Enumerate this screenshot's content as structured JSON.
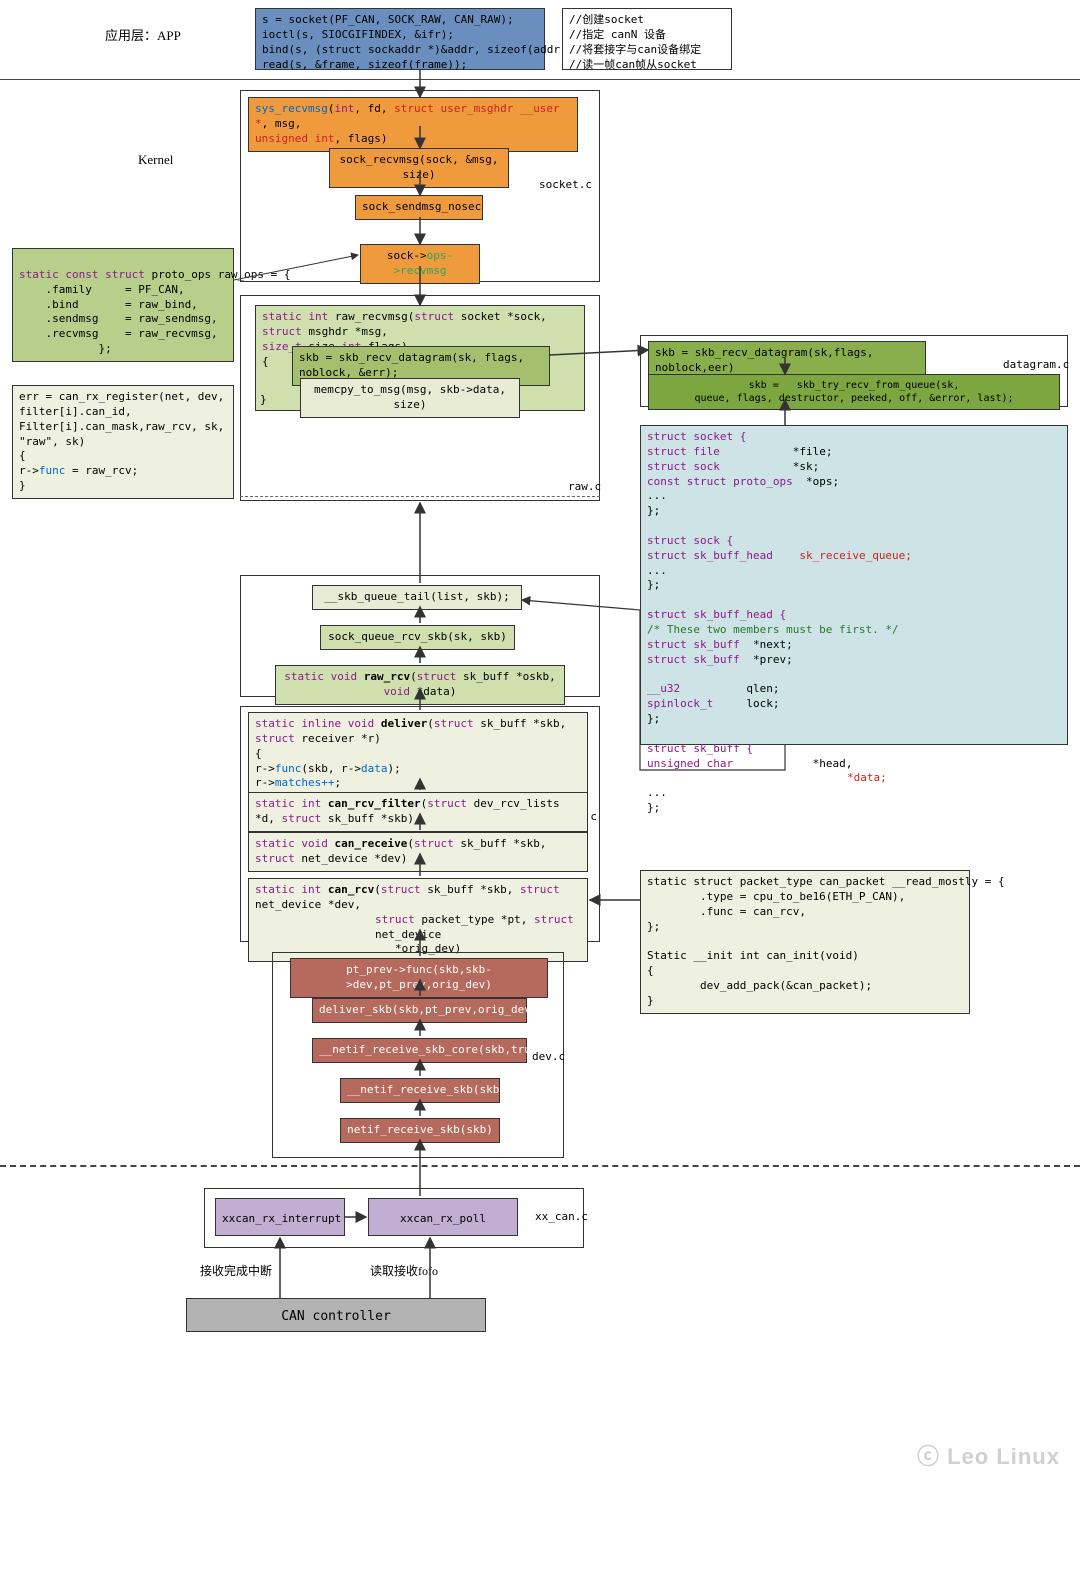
{
  "labels": {
    "app_layer": "应用层：APP",
    "kernel": "Kernel",
    "socket_c": "socket.c",
    "raw_c": "raw.c",
    "datagram_c": "datagram.c",
    "af_can_c": "af_can.c",
    "dev_c": "dev.c",
    "xx_can_c": "xx_can.c",
    "rx_done_irq": "接收完成中断",
    "read_rx_fifo": "读取接收fofo",
    "watermark": "ⓒ Leo Linux"
  },
  "app_code": "s = socket(PF_CAN, SOCK_RAW, CAN_RAW);\nioctl(s, SIOCGIFINDEX, &ifr);\nbind(s, (struct sockaddr *)&addr, sizeof(addr));\nread(s, &frame, sizeof(frame));",
  "app_comments": "//创建socket\n//指定 canN 设备\n//将套接字与can设备绑定\n//读一帧can帧从socket",
  "sys_recvmsg": {
    "tok1": "sys_recvmsg",
    "tok2": "(",
    "tok3": "int",
    "tok4": ", fd, ",
    "tok5": "struct user_msghdr __user *",
    "tok6": ", msg,",
    "tok7": "unsigned int",
    "tok8": ", flags)"
  },
  "sock_recvmsg": "sock_recvmsg(sock, &msg, size)",
  "sock_sendmsg": "sock_sendmsg_nosec",
  "sock_ops": {
    "pre": "sock->",
    "mid": "ops->recvmsg"
  },
  "proto_ops": "static const struct proto_ops raw_ops = {\n    .family     = PF_CAN,\n    .bind       = raw_bind,\n    .sendmsg    = raw_sendmsg,\n    .recvmsg    = raw_recvmsg,\n            };",
  "can_rx_reg": {
    "l1": "err = can_rx_register(net, dev, filter[i].can_id,",
    "l2": "Filter[i].can_mask,raw_rcv, sk, \"raw\", sk)",
    "l3": "{",
    "l4pre": "    r->",
    "l4kw": "func",
    "l4post": "   = raw_rcv;",
    "l5": "}"
  },
  "raw_recvmsg_hdr": {
    "p1": "static int ",
    "fn": "raw_recvmsg",
    "p2": "(",
    "kw1": "struct",
    "p3": " socket *sock, ",
    "kw2": "struct",
    "p4": " msghdr *msg,",
    "l2a": "size_t ",
    "l2b": "size,",
    "l2c": "int ",
    "l2d": "flags)",
    "br": "{"
  },
  "skb_recv_dg": "skb = skb_recv_datagram(sk, flags, noblock, &err);",
  "memcpy_to_msg": "memcpy_to_msg(msg, skb->data, size)",
  "raw_recvmsg_end": "}",
  "skb_recv_dg2": "skb = skb_recv_datagram(sk,flags, noblock,eer)",
  "skb_try_recv": "skb =   skb_try_recv_from_queue(sk,\nqueue, flags, destructor, peeked, off, &error, last);",
  "structs": {
    "socket_hdr": "struct socket {",
    "file": "        struct file",
    "file_m": "*file;",
    "sock": "        struct sock",
    "sock_m": "*sk;",
    "ops": "        const struct proto_ops",
    "ops_m": "*ops;",
    "dots": "            ...",
    "end": "};",
    "sock2_hdr": "struct sock {",
    "skbh": "        struct sk_buff_head",
    "skbh_m": "sk_receive_queue;",
    "skbuffh_hdr": "struct sk_buff_head {",
    "comment": "        /* These two members must be first. */",
    "next": "        struct sk_buff",
    "next_m": "*next;",
    "prev": "        struct sk_buff",
    "prev_m": "*prev;",
    "u32": "        __u32",
    "u32_m": "qlen;",
    "spin": "        spinlock_t",
    "spin_m": "lock;",
    "skbuff_hdr": "struct sk_buff {",
    "uchar": "        unsigned char",
    "uchar_m1": "*head,",
    "uchar_m2": "*data;"
  },
  "skb_queue_tail": "__skb_queue_tail(list, skb);",
  "sock_queue_rcv": "sock_queue_rcv_skb(sk, skb)",
  "raw_rcv": {
    "p1": "static void ",
    "fn": "raw_rcv",
    "p2": "(",
    "kw": "struct",
    "p3": " sk_buff *oskb, ",
    "kw2": "void",
    "p4": " *data)"
  },
  "deliver": {
    "p1": "static inline void ",
    "fn": "deliver",
    "p2": "(",
    "kw1": "struct",
    "p3": " sk_buff *skb, ",
    "kw2": "struct",
    "p4": " receiver *r)",
    "br": "{",
    "b1": "        r->",
    "b1_kw": "func",
    "b1_p": "(skb, r->",
    "b1_kw2": "data",
    "b1_p2": ");",
    "b2": "        r->",
    "b2_kw": "matches++",
    "b2_p": ";",
    "end": "}"
  },
  "can_rcv_filter": {
    "p1": "static int ",
    "fn": "can_rcv_filter",
    "p2": "(",
    "kw": "struct",
    "p3": " dev_rcv_lists *d, ",
    "kw2": "struct",
    "p4": " sk_buff *skb)"
  },
  "can_receive": {
    "p1": "static void ",
    "fn": "can_receive",
    "p2": "(",
    "kw": "struct",
    "p3": " sk_buff *skb, ",
    "kw2": "struct",
    "p4": " net_device *dev)"
  },
  "can_rcv": {
    "p1": "static int ",
    "fn": "can_rcv",
    "p2": "(",
    "kw": "struct",
    "p3": " sk_buff *skb, ",
    "kw2": "struct",
    "p4": " net_device *dev,",
    "l2kw": "struct",
    "l2p": " packet_type *pt, ",
    "l2kw2": "struct",
    "l2p2": " net_device",
    "l3": "*orig_dev)"
  },
  "packet_type": "static struct packet_type can_packet __read_mostly = {\n        .type = cpu_to_be16(ETH_P_CAN),\n        .func = can_rcv,\n};\n\nStatic __init int can_init(void)\n{\n        dev_add_pack(&can_packet);\n}",
  "pt_prev_func": "pt_prev->func(skb,skb->dev,pt_prev,orig_dev)",
  "deliver_skb": "deliver_skb(skb,pt_prev,orig_dev)",
  "netif_core": "__netif_receive_skb_core(skb,true)",
  "netif_recv": "__netif_receive_skb(skb)",
  "netif_recv2": "netif_receive_skb(skb)",
  "xxcan_irq": "xxcan_rx_interrupt",
  "xxcan_poll": "xxcan_rx_poll",
  "can_ctrl": "CAN controller"
}
